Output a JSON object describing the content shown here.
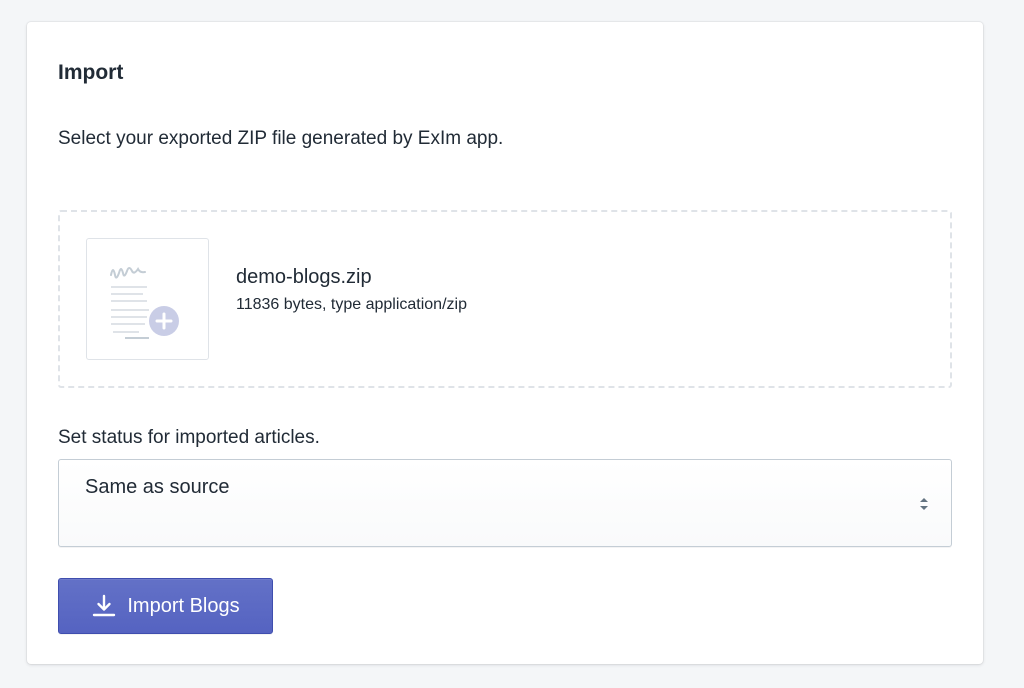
{
  "card": {
    "title": "Import",
    "intro": "Select your exported ZIP file generated by ExIm app."
  },
  "dropzone": {
    "icon": "file-upload-icon",
    "file_name": "demo-blogs.zip",
    "file_meta": "11836 bytes, type application/zip"
  },
  "status": {
    "label": "Set status for imported articles.",
    "selected": "Same as source",
    "arrows_icon": "select-arrows-icon"
  },
  "import_button": {
    "label": "Import Blogs",
    "icon": "download-icon"
  },
  "colors": {
    "accent": "#5c6ac4",
    "text": "#212b36",
    "border": "#dfe3e8",
    "background": "#f4f6f8"
  }
}
